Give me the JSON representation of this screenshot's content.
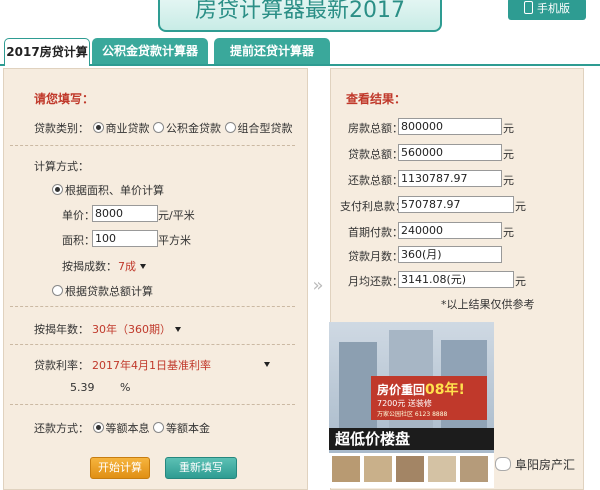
{
  "header": {
    "title": "房贷计算器最新2017",
    "mobile_label": "手机版"
  },
  "tabs": [
    "2017房贷计算器",
    "公积金贷款计算器",
    "提前还贷计算器"
  ],
  "form": {
    "heading": "请您填写：",
    "loan_type_label": "贷款类别：",
    "loan_types": [
      "商业贷款",
      "公积金贷款",
      "组合型贷款"
    ],
    "calc_method_label": "计算方式：",
    "method_area": "根据面积、单价计算",
    "unit_price_label": "单价：",
    "unit_price_value": "8000",
    "unit_price_unit": "元/平米",
    "area_label": "面积：",
    "area_value": "100",
    "area_unit": "平方米",
    "ratio_label": "按揭成数：",
    "ratio_value": "7成",
    "method_total": "根据贷款总额计算",
    "years_label": "按揭年数：",
    "years_value": "30年（360期）",
    "rate_label": "贷款利率：",
    "rate_value": "2017年4月1日基准利率",
    "rate_number": "5.39",
    "rate_percent": "%",
    "repay_label": "还款方式：",
    "repay_options": [
      "等额本息",
      "等额本金"
    ],
    "calc_button": "开始计算",
    "reset_button": "重新填写"
  },
  "results": {
    "heading": "查看结果：",
    "rows": [
      {
        "label": "房款总额：",
        "value": "800000",
        "unit": "元"
      },
      {
        "label": "贷款总额：",
        "value": "560000",
        "unit": "元"
      },
      {
        "label": "还款总额：",
        "value": "1130787.97",
        "unit": "元"
      },
      {
        "label": "支付利息款：",
        "value": "570787.97",
        "unit": "元"
      },
      {
        "label": "首期付款：",
        "value": "240000",
        "unit": "元"
      },
      {
        "label": "贷款月数：",
        "value": "360(月)",
        "unit": ""
      },
      {
        "label": "月均还款：",
        "value": "3141.08(元)",
        "unit": "元"
      }
    ],
    "note": "*以上结果仅供参考"
  },
  "ad": {
    "line1_a": "房价重回",
    "line1_b": "08年!",
    "line2": "7200元 送装修",
    "line3": "万家公园社区 6123 8888",
    "band": "超低价楼盘"
  },
  "watermark": "阜阳房产汇"
}
